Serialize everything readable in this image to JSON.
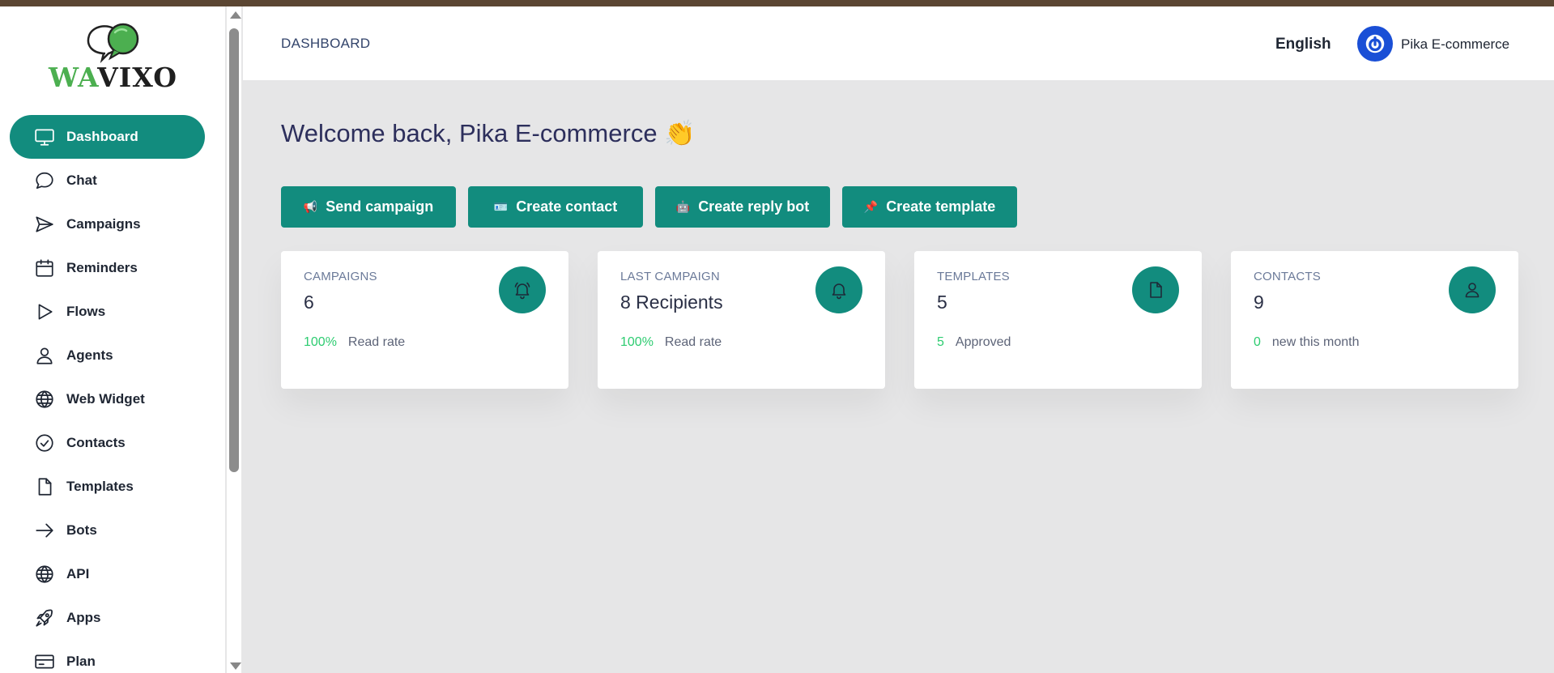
{
  "brand": {
    "logo_wa": "WA",
    "logo_vixo": "VIXO",
    "green": "#4caf50",
    "accent": "#128c7e"
  },
  "sidebar": {
    "items": [
      {
        "label": "Dashboard",
        "icon": "monitor-icon",
        "active": true
      },
      {
        "label": "Chat",
        "icon": "chat-bubble-icon"
      },
      {
        "label": "Campaigns",
        "icon": "send-icon"
      },
      {
        "label": "Reminders",
        "icon": "calendar-icon"
      },
      {
        "label": "Flows",
        "icon": "play-icon"
      },
      {
        "label": "Agents",
        "icon": "user-icon"
      },
      {
        "label": "Web Widget",
        "icon": "globe-icon"
      },
      {
        "label": "Contacts",
        "icon": "check-circle-icon"
      },
      {
        "label": "Templates",
        "icon": "file-icon"
      },
      {
        "label": "Bots",
        "icon": "arrow-right-icon"
      },
      {
        "label": "API",
        "icon": "globe-icon"
      },
      {
        "label": "Apps",
        "icon": "rocket-icon"
      },
      {
        "label": "Plan",
        "icon": "credit-card-icon"
      }
    ]
  },
  "header": {
    "breadcrumb": "DASHBOARD",
    "language": "English",
    "user_name": "Pika E-commerce"
  },
  "main": {
    "welcome": "Welcome back, Pika E-commerce 👏",
    "actions": [
      {
        "emoji": "📢",
        "label": "Send campaign"
      },
      {
        "emoji": "🪪",
        "label": "Create contact"
      },
      {
        "emoji": "🤖",
        "label": "Create reply bot"
      },
      {
        "emoji": "📌",
        "label": "Create template"
      }
    ],
    "stats": [
      {
        "caption": "CAMPAIGNS",
        "value": "6",
        "highlight": "100%",
        "note": "Read rate",
        "icon": "bell-icon"
      },
      {
        "caption": "LAST CAMPAIGN",
        "value": "8 Recipients",
        "highlight": "100%",
        "note": "Read rate",
        "icon": "bell-icon"
      },
      {
        "caption": "TEMPLATES",
        "value": "5",
        "highlight": "5",
        "note": "Approved",
        "icon": "file-icon"
      },
      {
        "caption": "CONTACTS",
        "value": "9",
        "highlight": "0",
        "note": "new this month",
        "icon": "user-icon"
      }
    ]
  }
}
